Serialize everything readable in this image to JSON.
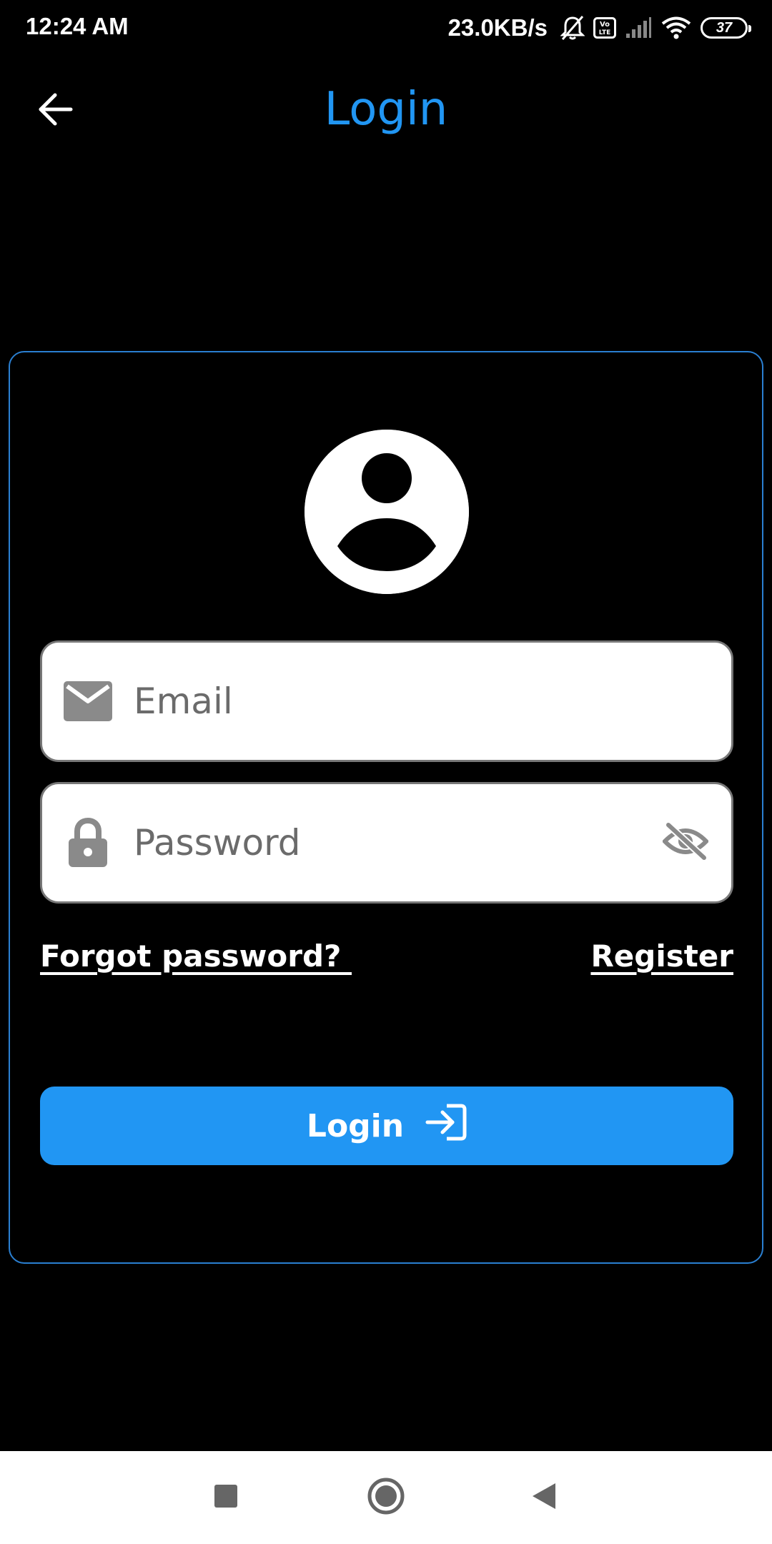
{
  "status_bar": {
    "time": "12:24 AM",
    "network_speed": "23.0KB/s",
    "battery_level": "37",
    "icons": [
      "bell-off-icon",
      "volte-icon",
      "signal-icon",
      "wifi-icon",
      "battery-icon"
    ]
  },
  "app_bar": {
    "title": "Login",
    "back_icon": "arrow-left-icon"
  },
  "form": {
    "avatar_icon": "account-circle-icon",
    "email": {
      "placeholder": "Email",
      "value": "",
      "icon": "mail-icon"
    },
    "password": {
      "placeholder": "Password",
      "value": "",
      "icon": "lock-icon",
      "visibility_icon": "eye-off-icon"
    },
    "forgot_password_label": "Forgot password? ",
    "register_label": "Register",
    "login_button_label": "Login",
    "login_button_icon": "login-icon"
  },
  "nav_bar": {
    "icons": [
      "recents-icon",
      "home-icon",
      "back-icon"
    ]
  },
  "colors": {
    "accent": "#2196F3",
    "background": "#000000",
    "card_border": "#2a7fd1",
    "input_background": "#ffffff",
    "icon_grey": "#8a8a8a"
  }
}
